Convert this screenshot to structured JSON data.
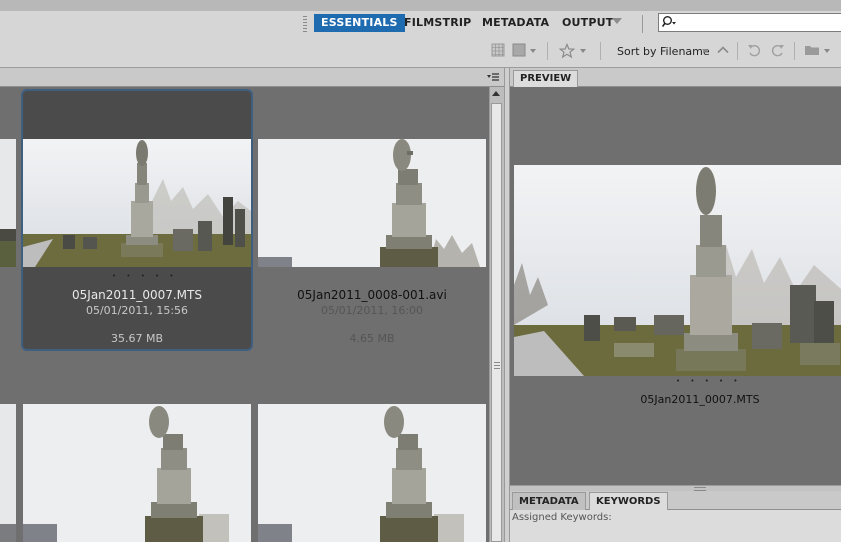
{
  "workspaces": [
    {
      "label": "ESSENTIALS",
      "active": true
    },
    {
      "label": "FILMSTRIP",
      "active": false
    },
    {
      "label": "METADATA",
      "active": false
    },
    {
      "label": "OUTPUT",
      "active": false
    }
  ],
  "search": {
    "placeholder": ""
  },
  "toolbar": {
    "sort_label": "Sort by Filename"
  },
  "colors": {
    "accent": "#1e6bb0",
    "selection_border": "#3f5f80",
    "panel_bg": "#6f6f6f"
  },
  "icons": [
    "search-icon",
    "grid-icon",
    "stack-icon",
    "star-icon",
    "sort-ascending-icon",
    "rotate-left-icon",
    "rotate-right-icon",
    "folder-icon",
    "panel-menu-icon"
  ],
  "thumbnails": [
    {
      "name": "05Jan2011_0007.MTS",
      "date": "05/01/2011, 15:56",
      "size": "35.67 MB",
      "rating": "• • • • •",
      "selected": true
    },
    {
      "name": "05Jan2011_0008-001.avi",
      "date": "05/01/2011, 16:00",
      "size": "4.65 MB",
      "rating": "",
      "selected": false
    }
  ],
  "preview": {
    "tab_label": "PREVIEW",
    "filename": "05Jan2011_0007.MTS",
    "rating": "• • • • •"
  },
  "metadata_panel": {
    "tabs": [
      {
        "label": "METADATA"
      },
      {
        "label": "KEYWORDS"
      }
    ],
    "assigned_label": "Assigned Keywords:"
  }
}
